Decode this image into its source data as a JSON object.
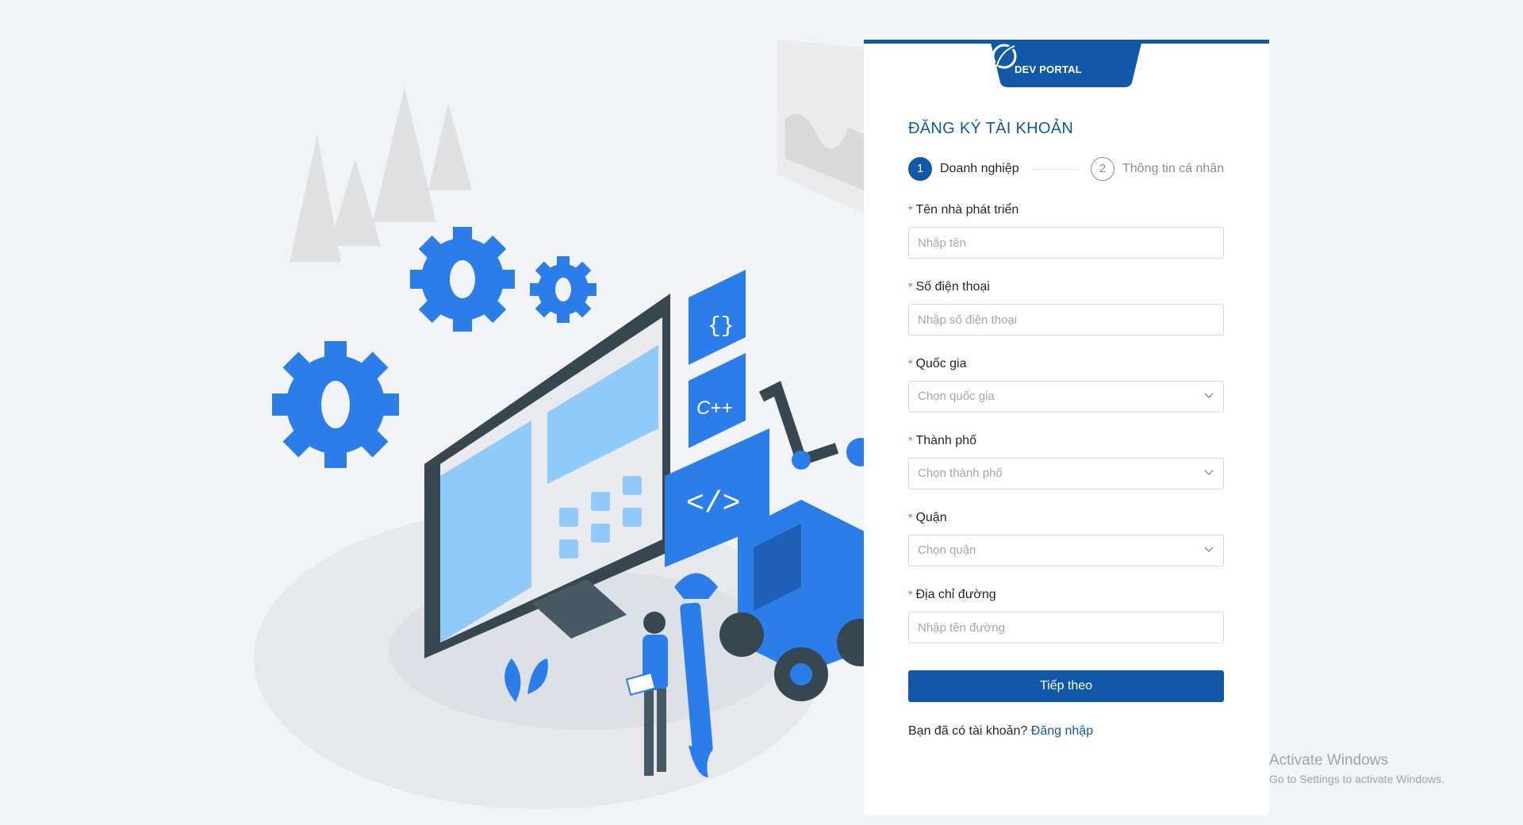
{
  "brand": {
    "name": "DEV PORTAL"
  },
  "form": {
    "title": "ĐĂNG KÝ TÀI KHOẢN",
    "steps": [
      {
        "number": "1",
        "label": "Doanh nghiệp",
        "active": true
      },
      {
        "number": "2",
        "label": "Thông tin cá nhân",
        "active": false
      }
    ],
    "required_mark": "*",
    "fields": {
      "developer_name": {
        "label": "Tên nhà phát triển",
        "placeholder": "Nhập tên"
      },
      "phone": {
        "label": "Số điện thoại",
        "placeholder": "Nhập số điện thoại"
      },
      "country": {
        "label": "Quốc gia",
        "placeholder": "Chọn quốc gia"
      },
      "city": {
        "label": "Thành phố",
        "placeholder": "Chọn thành phố"
      },
      "district": {
        "label": "Quận",
        "placeholder": "Chọn quận"
      },
      "street": {
        "label": "Địa chỉ đường",
        "placeholder": "Nhập tên đường"
      }
    },
    "next_button": "Tiếp theo",
    "login_prompt": "Bạn đã có tài khoản?",
    "login_link": "Đăng nhập"
  },
  "illustration": {
    "code_tiles": [
      "{}",
      "C++",
      "</>"
    ]
  },
  "watermark": {
    "title": "Activate Windows",
    "subtitle": "Go to Settings to activate Windows."
  },
  "colors": {
    "primary": "#1159a8",
    "accent": "#2b7de9",
    "background": "#f1f3f6",
    "required": "#ff4d4f"
  }
}
